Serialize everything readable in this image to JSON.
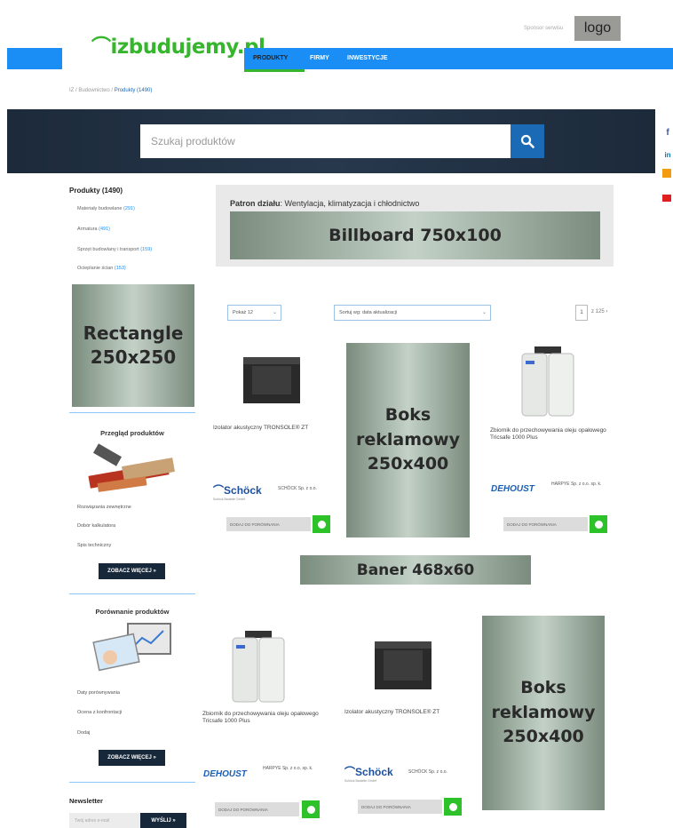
{
  "header": {
    "logo_text": "izbudujemy.pl",
    "sponsor_text": "Sponsor serwisu",
    "sponsor_logo": "logo",
    "nav": [
      "PRODUKTY",
      "FIRMY",
      "INWESTYCJE"
    ]
  },
  "breadcrumb": {
    "path": "IZ / Budownictwo / ",
    "current": "Produkty (1490)"
  },
  "search": {
    "placeholder": "Szukaj produktów"
  },
  "sidebar": {
    "title": "Produkty (1490)",
    "categories": [
      {
        "label": "Materiały budowlane",
        "count": "(291)"
      },
      {
        "label": "Armatura",
        "count": "(491)"
      },
      {
        "label": "Sprzęt budowlany i transport",
        "count": "(159)"
      },
      {
        "label": "Ocieplanie ścian",
        "count": "(153)"
      }
    ],
    "ad_rectangle": "Rectangle 250x250",
    "review": {
      "heading": "Przegląd produktów",
      "links": [
        "Rozwiązania zewnętrzne",
        "Dobór kalkulatora",
        "Spis techniczny"
      ],
      "button": "ZOBACZ WIĘCEJ »"
    },
    "compare": {
      "heading": "Porównanie produktów",
      "links": [
        "Daty porównywania",
        "Ocena z konfrontacji",
        "Dodaj"
      ],
      "button": "ZOBACZ WIĘCEJ »"
    },
    "newsletter": {
      "title": "Newsletter",
      "placeholder": "Twój adres e-mail",
      "button": "WYŚLIJ »"
    }
  },
  "patron": {
    "label": "Patron działu",
    "value": "Wentylacja, klimatyzacja i chłodnictwo",
    "billboard": "Billboard 750x100"
  },
  "filters": {
    "per_page": "Pokaż 12",
    "sort": "Sortuj wg: data aktualizacji",
    "page": "1",
    "page_of": "z 125"
  },
  "ads": {
    "boks1": "Boks reklamowy 250x400",
    "baner": "Baner 468x60",
    "boks2": "Boks reklamowy 250x400"
  },
  "products": [
    {
      "name": "Izolator akustyczny TRONSOLE® ZT",
      "brand": "Schöck",
      "brand_sub": "Schöck Bauteile GmbH",
      "company": "SCHÖCK Sp. z o.o.",
      "compare": "DODAJ DO PORÓWNANIA"
    },
    {
      "name": "Zbiornik do przechowywania oleju opałowego Tricsafe 1000 Plus",
      "brand": "DEHOUST",
      "company": "HARPYE Sp. z o.o. sp. k.",
      "compare": "DODAJ DO PORÓWNANIA"
    },
    {
      "name": "Zbiornik do przechowywania oleju opałowego Tricsafe 1000 Plus",
      "brand": "DEHOUST",
      "company": "HARPYE Sp. z o.o. sp. k.",
      "compare": "DODAJ DO PORÓWNANIA"
    },
    {
      "name": "Izolator akustyczny TRONSOLE® ZT",
      "brand": "Schöck",
      "brand_sub": "Schöck Bauteile GmbH",
      "company": "SCHÖCK Sp. z o.o.",
      "compare": "DODAJ DO PORÓWNANIA"
    }
  ],
  "social": [
    "f",
    "in",
    "rss",
    "yt"
  ],
  "colors": {
    "accent_blue": "#1a8ef5",
    "accent_green": "#35b62c",
    "dark_navy": "#16283a"
  }
}
